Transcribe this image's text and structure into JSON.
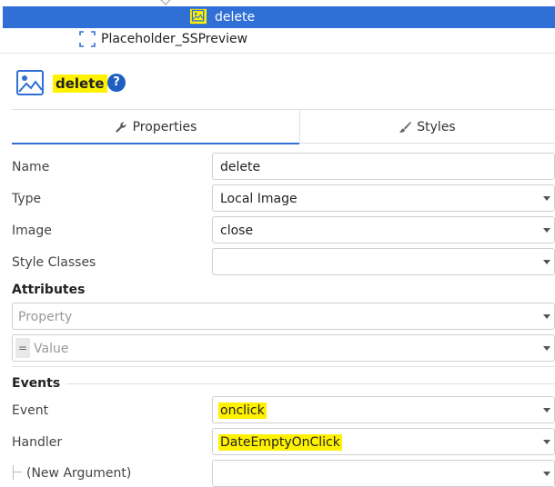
{
  "tree": {
    "selected_label": "delete",
    "other_label": "Placeholder_SSPreview"
  },
  "header": {
    "title": "delete",
    "help": "?"
  },
  "tabs": {
    "properties": "Properties",
    "styles": "Styles"
  },
  "properties": {
    "name_label": "Name",
    "name_value": "delete",
    "type_label": "Type",
    "type_value": "Local Image",
    "image_label": "Image",
    "image_value": "close",
    "style_classes_label": "Style Classes",
    "style_classes_value": ""
  },
  "attributes": {
    "section_title": "Attributes",
    "property_placeholder": "Property",
    "eq_symbol": "=",
    "value_placeholder": "Value"
  },
  "events": {
    "section_title": "Events",
    "event_label": "Event",
    "event_value": "onclick",
    "handler_label": "Handler",
    "handler_value": "DateEmptyOnClick",
    "new_argument_label": "(New Argument)",
    "new_argument_value": ""
  },
  "colors": {
    "selection": "#2f6fd6",
    "highlight": "#fff200",
    "help_badge": "#1f5fc0"
  }
}
